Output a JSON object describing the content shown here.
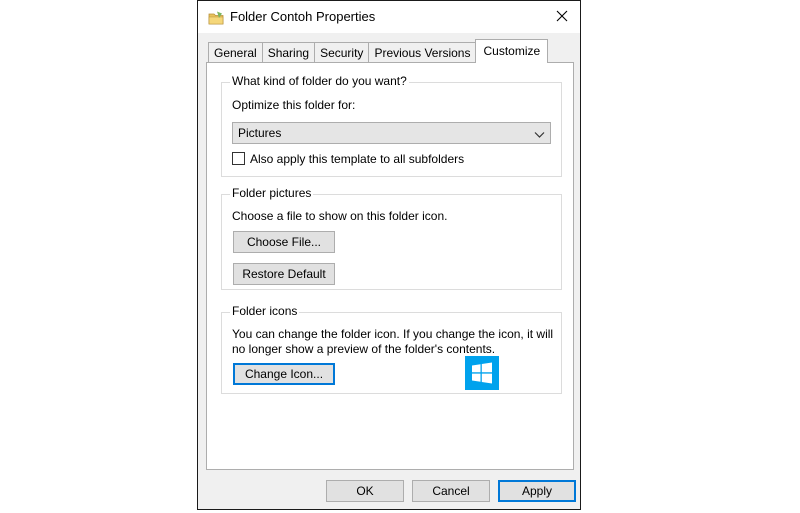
{
  "window": {
    "title": "Folder Contoh Properties",
    "close_glyph": "✕"
  },
  "tabs": [
    {
      "label": "General",
      "active": false
    },
    {
      "label": "Sharing",
      "active": false
    },
    {
      "label": "Security",
      "active": false
    },
    {
      "label": "Previous Versions",
      "active": false
    },
    {
      "label": "Customize",
      "active": true
    }
  ],
  "folder_type": {
    "legend": "What kind of folder do you want?",
    "optimize_label": "Optimize this folder for:",
    "selected_value": "Pictures",
    "apply_subfolders_label": "Also apply this template to all subfolders",
    "apply_subfolders_checked": false
  },
  "folder_pictures": {
    "legend": "Folder pictures",
    "description": "Choose a file to show on this folder icon.",
    "choose_file_label": "Choose File...",
    "restore_default_label": "Restore Default"
  },
  "folder_icons": {
    "legend": "Folder icons",
    "description_line1": "You can change the folder icon. If you change the icon, it will",
    "description_line2": "no longer show a preview of the folder's contents.",
    "change_icon_label": "Change Icon..."
  },
  "footer": {
    "ok_label": "OK",
    "cancel_label": "Cancel",
    "apply_label": "Apply"
  },
  "colors": {
    "accent": "#0078d7",
    "windows_logo": "#00a2ed",
    "folder_yellow": "#e8c25a"
  },
  "icons": {
    "title": "folder-icon",
    "close": "close-icon",
    "dropdown": "chevron-down-icon",
    "preview": "windows-logo-icon"
  }
}
